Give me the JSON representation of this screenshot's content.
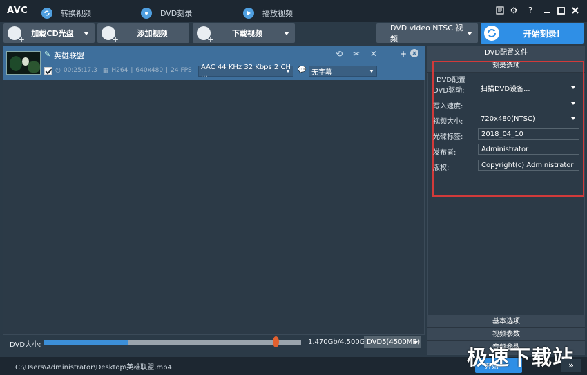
{
  "app": {
    "logo": "AVC"
  },
  "tabs": [
    {
      "label": "转换视频"
    },
    {
      "label": "DVD刻录"
    },
    {
      "label": "播放视频"
    }
  ],
  "toolbar": {
    "load_cd": "加载CD光盘",
    "add_video": "添加视频",
    "download_video": "下载视频",
    "profile": "DVD video NTSC 视频",
    "burn": "开始刻录!"
  },
  "file": {
    "name": "英雄联盟",
    "duration": "00:25:17.3",
    "codec": "H264",
    "resolution": "640x480",
    "fps": "24 FPS",
    "audio": "AAC 44 KHz 32 Kbps 2 CH ...",
    "subtitle": "无字幕"
  },
  "size": {
    "label": "DVD大小:",
    "text": "1.470Gb/4.500Gb",
    "disc": "DVD5(4500MB)",
    "used_fraction": 0.327
  },
  "status": {
    "path": "C:\\Users\\Administrator\\Desktop\\英雄联盟.mp4"
  },
  "right": {
    "header1": "DVD配置文件",
    "header2": "刻录选项",
    "group": "DVD配置",
    "fields": [
      {
        "label": "DVD驱动:",
        "value": "扫描DVD设备..."
      },
      {
        "label": "写入速度:",
        "value": ""
      },
      {
        "label": "视频大小:",
        "value": "720x480(NTSC)"
      },
      {
        "label": "光碟标签:",
        "value": "2018_04_10"
      },
      {
        "label": "发布者:",
        "value": "Administrator"
      },
      {
        "label": "版权:",
        "value": "Copyright(c) Administrator"
      }
    ],
    "bottom_headers": [
      "基本选项",
      "视频参数",
      "音频参数"
    ]
  },
  "watermark": {
    "text": "极速下载站",
    "button": "开始"
  },
  "colors": {
    "accent": "#2f8fe6",
    "highlight": "#d23a3a"
  }
}
